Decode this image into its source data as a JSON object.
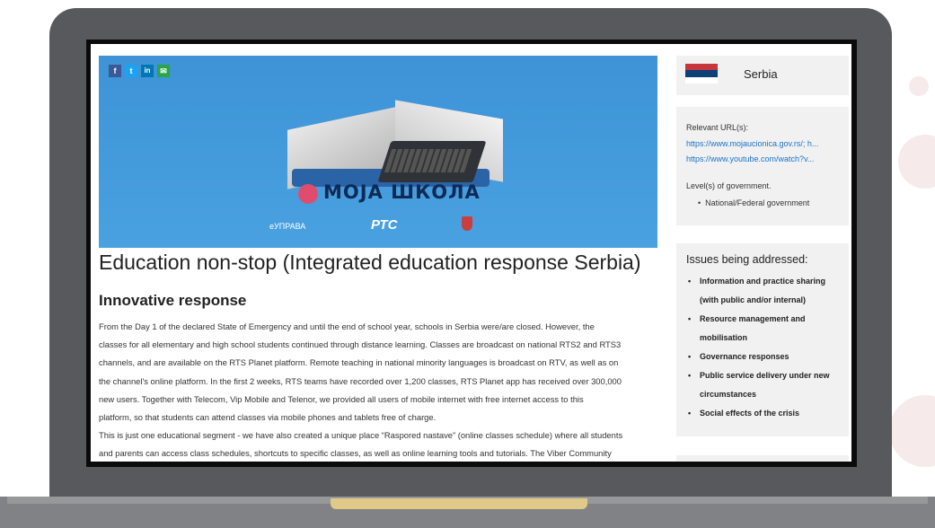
{
  "share": {
    "facebook": "f",
    "twitter": "t",
    "linkedin": "in",
    "email": "✉"
  },
  "hero": {
    "title": "МОЈА ШКОЛА",
    "logo_left": "eУПРАВА",
    "logo_center": "РТС"
  },
  "article": {
    "title": "Education non-stop (Integrated education response Serbia)",
    "section_title": "Innovative response",
    "lines": [
      "From the Day 1 of the declared State of Emergency and until the end of school year, schools in Serbia were/are closed. However, the",
      "classes for all elementary and high school students continued through distance learning. Classes are broadcast on national RTS2 and RTS3",
      "channels, and are available on the RTS Planet platform. Remote teaching in national minority languages is broadcast on RTV, as well as on",
      "the channel's online platform. In the first 2 weeks, RTS teams have recorded over 1,200 classes, RTS Planet app has received over 300,000",
      "new users. Together with Telecom, Vip Mobile and Telenor, we provided all users of mobile internet with free internet access to this",
      "platform, so that students can attend classes via mobile phones and tablets free of charge.",
      "This is just one educational segment - we have also created a unique place “Raspored nastave” (online classes schedule) where all students",
      "and parents can access class schedules, shortcuts to specific classes, as well as online learning tools and tutorials. The Viber Community"
    ]
  },
  "sidebar": {
    "country": "Serbia",
    "relevant_label": "Relevant URL(s):",
    "urls": [
      "https://www.mojaucionica.gov.rs/; h...",
      "https://www.youtube.com/watch?v..."
    ],
    "levels_label": "Level(s) of government.",
    "levels": [
      "National/Federal government"
    ],
    "issues_title": "Issues being addressed:",
    "issues": [
      "Information and practice sharing (with public and/or internal)",
      "Resource management and mobilisation",
      "Governance responses",
      "Public service delivery under new circumstances",
      "Social effects of the crisis"
    ]
  },
  "colors": {
    "laptop": "#57595c",
    "hero_blue": "#4aa1e0",
    "link": "#1a73c9",
    "sidebar_bg": "#f1f1f1"
  }
}
